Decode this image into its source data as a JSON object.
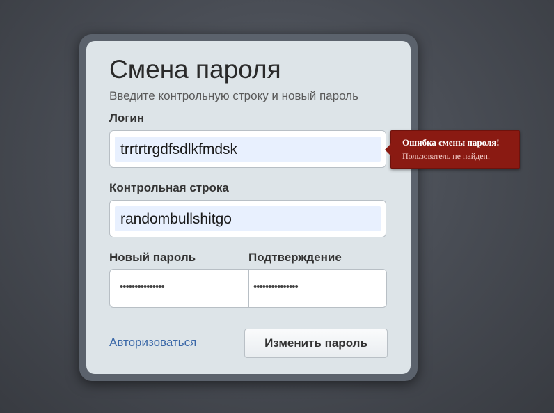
{
  "form": {
    "title": "Смена пароля",
    "subtitle": "Введите контрольную строку и новый пароль",
    "login": {
      "label": "Логин",
      "value": "trrtrtrgdfsdlkfmdsk"
    },
    "control": {
      "label": "Контрольная строка",
      "value": "randombullshitgo"
    },
    "new_password": {
      "label": "Новый пароль",
      "value": "•••••••••••••••"
    },
    "confirm": {
      "label": "Подтверждение",
      "value": "•••••••••••••••"
    },
    "auth_link": "Авторизоваться",
    "submit_label": "Изменить пароль"
  },
  "error": {
    "title": "Ошибка смены пароля!",
    "message": "Пользователь не найден."
  },
  "colors": {
    "card_background": "#dde4e8",
    "error_background": "#8a1a12",
    "link": "#3b68a8",
    "autofill": "#e8f0fe"
  }
}
